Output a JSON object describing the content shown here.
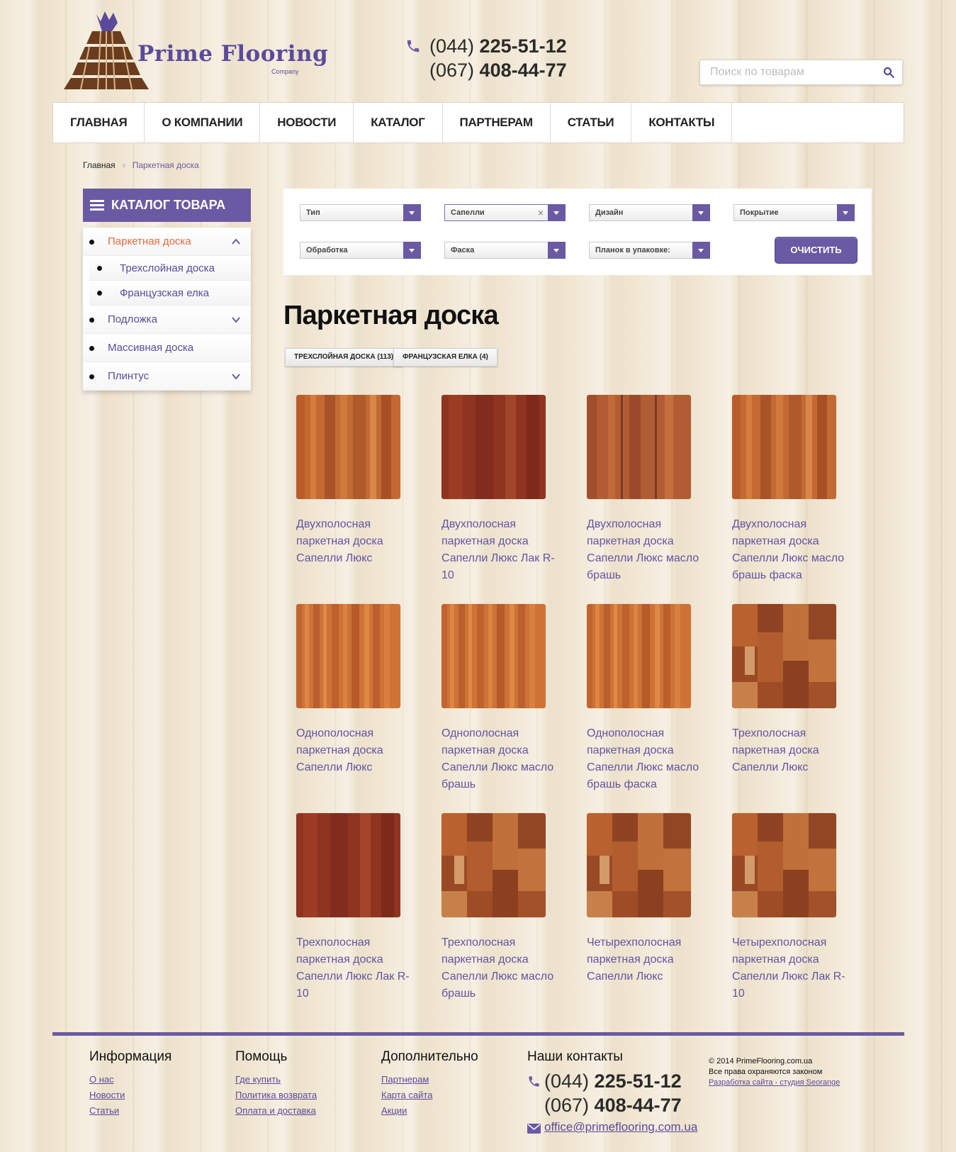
{
  "brand": {
    "name": "Prime Flooring",
    "sub": "Company"
  },
  "header": {
    "phones": [
      {
        "code": "(044)",
        "number": "225-51-12"
      },
      {
        "code": "(067)",
        "number": "408-44-77"
      }
    ],
    "search_placeholder": "Поиск по товарам"
  },
  "nav": [
    "ГЛАВНАЯ",
    "О КОМПАНИИ",
    "НОВОСТИ",
    "КАТАЛОГ",
    "ПАРТНЕРАМ",
    "СТАТЬИ",
    "КОНТАКТЫ"
  ],
  "breadcrumb": {
    "home": "Главная",
    "sep": "›",
    "current": "Паркетная доска"
  },
  "sidebar": {
    "title": "КАТАЛОГ ТОВАРА",
    "items": [
      {
        "label": "Паркетная доска",
        "active": true,
        "expanded": true,
        "chevron": "chevron-up-icon"
      },
      {
        "label": "Трехслойная доска",
        "sub": true
      },
      {
        "label": "Французская елка",
        "sub": true
      },
      {
        "label": "Подложка",
        "chevron": "chevron-down-icon"
      },
      {
        "label": "Массивная доска"
      },
      {
        "label": "Плинтус",
        "chevron": "chevron-down-icon"
      }
    ]
  },
  "filters": {
    "selects": [
      "Тип",
      "Сапелли",
      "Дизайн",
      "Покрытие",
      "Обработка",
      "Фаска",
      "Планок в упаковке:"
    ],
    "selected_clear": "×",
    "clear_button": "ОЧИСТИТЬ"
  },
  "page_title": "Паркетная доска",
  "chips": [
    "ТРЕХСЛОЙНАЯ ДОСКА (113)",
    "ФРАНЦУЗСКАЯ ЕЛКА (4)"
  ],
  "products": [
    {
      "name": "Двухполосная паркетная доска Сапелли Люкс"
    },
    {
      "name": "Двухполосная паркетная доска Сапелли Люкс Лак R-10"
    },
    {
      "name": "Двухполосная паркетная доска Сапелли Люкс масло брашь"
    },
    {
      "name": "Двухполосная паркетная доска Сапелли Люкс масло брашь фаска"
    },
    {
      "name": "Однополосная паркетная доска Сапелли Люкс"
    },
    {
      "name": "Однополосная паркетная доска Сапелли Люкс масло брашь"
    },
    {
      "name": "Однополосная паркетная доска Сапелли Люкс масло брашь фаска"
    },
    {
      "name": "Трехполосная паркетная доска Сапелли Люкс"
    },
    {
      "name": "Трехполосная паркетная доска Сапелли Люкс Лак R-10"
    },
    {
      "name": "Трехполосная паркетная доска Сапелли Люкс масло брашь"
    },
    {
      "name": "Четырехполосная паркетная доска Сапелли Люкс"
    },
    {
      "name": "Четырехполосная паркетная доска Сапелли Люкс Лак R-10"
    }
  ],
  "footer": {
    "info": {
      "title": "Информация",
      "links": [
        "О нас",
        "Новости",
        "Статьи"
      ]
    },
    "help": {
      "title": "Помощь",
      "links": [
        "Где купить",
        "Политика возврата",
        "Оплата и доставка"
      ]
    },
    "extra": {
      "title": "Дополнительно",
      "links": [
        "Партнерам",
        "Карта сайта",
        "Акции"
      ]
    },
    "contacts": {
      "title": "Наши контакты",
      "phones": [
        {
          "code": "(044)",
          "number": "225-51-12"
        },
        {
          "code": "(067)",
          "number": "408-44-77"
        }
      ],
      "email": "office@primeflooring.com.ua"
    },
    "copyright": "© 2014 PrimeFlooring.com.ua",
    "rights": "Все права охраняются законом",
    "dev_link": "Разработка сайта - студия Seorange"
  },
  "colors": {
    "accent": "#6a5aa3",
    "link": "#5b4a9b",
    "active": "#e8673b"
  }
}
